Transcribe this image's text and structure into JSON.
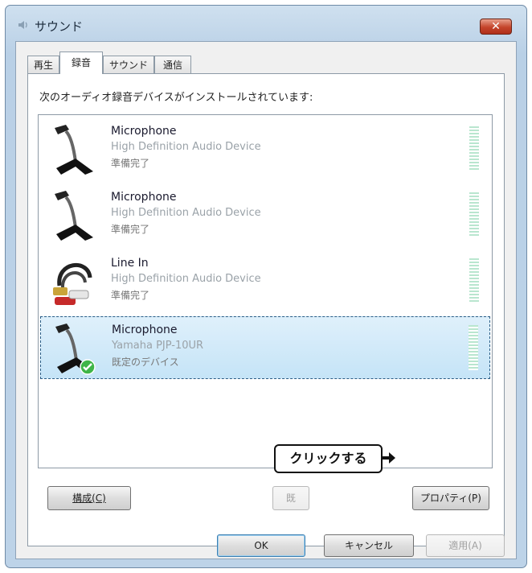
{
  "window": {
    "title": "サウンド",
    "close_label": "✕"
  },
  "tabs": [
    {
      "label": "再生",
      "active": false
    },
    {
      "label": "録音",
      "active": true
    },
    {
      "label": "サウンド",
      "active": false
    },
    {
      "label": "通信",
      "active": false
    }
  ],
  "instruction": "次のオーディオ録音デバイスがインストールされています:",
  "devices": [
    {
      "name": "Microphone",
      "description": "High Definition Audio Device",
      "status": "準備完了",
      "icon": "microphone-icon",
      "selected": false
    },
    {
      "name": "Microphone",
      "description": "High Definition Audio Device",
      "status": "準備完了",
      "icon": "microphone-icon",
      "selected": false
    },
    {
      "name": "Line In",
      "description": "High Definition Audio Device",
      "status": "準備完了",
      "icon": "line-in-cable-icon",
      "selected": false
    },
    {
      "name": "Microphone",
      "description": "Yamaha PJP-10UR",
      "status": "既定のデバイス",
      "icon": "microphone-icon",
      "selected": true,
      "default_badge": "check-icon"
    }
  ],
  "buttons": {
    "configure": "構成(C)",
    "set_default_partial": "既",
    "properties": "プロパティ(P)",
    "ok": "OK",
    "cancel": "キャンセル",
    "apply": "適用(A)"
  },
  "callout": {
    "text": "クリックする"
  },
  "colors": {
    "selection_bg": "#c5e4f7",
    "meter": "#b9e6cf",
    "default_check": "#3fb548"
  }
}
